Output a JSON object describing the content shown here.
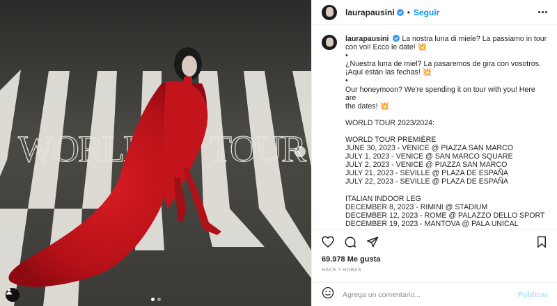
{
  "media": {
    "overlay_left": "WORLD",
    "overlay_right": "TOUR",
    "carousel_dots": 2,
    "active_dot": 0
  },
  "post": {
    "username": "laurapausini",
    "follow_separator": "•",
    "follow_label": "Seguir",
    "caption_username": "laurapausini",
    "caption_lines": [
      "La nostra luna di miele? La passiamo in tour",
      "con voi! Ecco le date! 💥",
      "•",
      "¿Nuestra luna de miel? La pasaremos de gira con vosotros.",
      "¡Aquí están las fechas! 💥",
      "•",
      "Our honeymoon? We're spending it on tour with you! Here are",
      "the dates! 💥",
      "",
      "WORLD TOUR 2023/2024:",
      "",
      "WORLD TOUR PREMIÈRE",
      "JUNE 30, 2023 - VENICE @ PIAZZA SAN MARCO",
      "JULY 1, 2023 - VENICE @ SAN MARCO SQUARE",
      "JULY 2, 2023 - VENICE @ PIAZZA SAN MARCO",
      "JULY 21, 2023 - SEVILLE @ PLAZA DE ESPAÑA",
      "JULY 22, 2023 - SEVILLE @ PLAZA DE ESPAÑA",
      "",
      "ITALIAN INDOOR LEG",
      "DECEMBER 8, 2023 - RIMINI @ STADIUM",
      "DECEMBER 12, 2023 - ROME @ PALAZZO DELLO SPORT",
      "DECEMBER 19, 2023 - MANTOVA @ PALA UNICAL"
    ],
    "likes": "69.978 Me gusta",
    "time": "HACE 7 HORAS",
    "comment_placeholder": "Agrega un comentario...",
    "publish_label": "Publicar"
  },
  "colors": {
    "accent": "#0095f6",
    "publish_disabled": "#b2dffc",
    "verified": "#3897f0",
    "dress": "#c8141b"
  },
  "icons": [
    "verified-badge-icon",
    "more-options-icon",
    "heart-icon",
    "comment-icon",
    "share-icon",
    "bookmark-icon",
    "emoji-icon",
    "chevron-right-icon",
    "user-tag-icon"
  ]
}
